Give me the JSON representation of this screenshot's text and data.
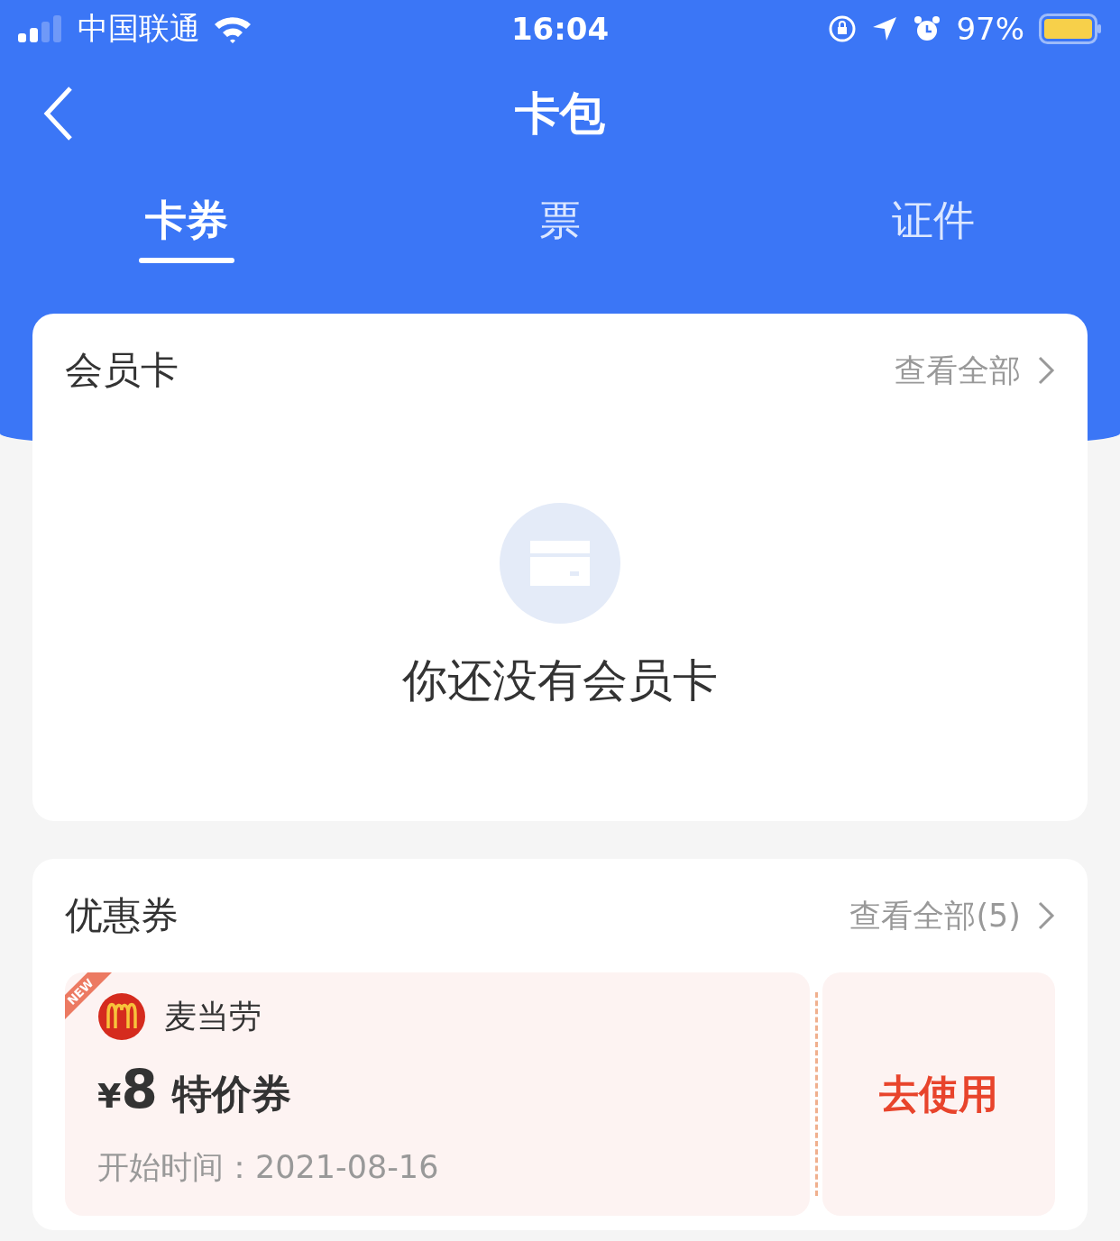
{
  "status_bar": {
    "carrier": "中国联通",
    "time": "16:04",
    "battery": "97%"
  },
  "nav": {
    "title": "卡包"
  },
  "tabs": [
    {
      "label": "卡券",
      "selected": true
    },
    {
      "label": "票",
      "selected": false
    },
    {
      "label": "证件",
      "selected": false
    }
  ],
  "member_cards": {
    "title": "会员卡",
    "link": "查看全部",
    "empty_text": "你还没有会员卡"
  },
  "coupons": {
    "title": "优惠券",
    "link": "查看全部(5)",
    "items": [
      {
        "badge": "NEW",
        "merchant": "麦当劳",
        "currency": "¥",
        "amount": "8",
        "type": "特价券",
        "start": "开始时间：2021-08-16",
        "action": "去使用"
      }
    ]
  }
}
